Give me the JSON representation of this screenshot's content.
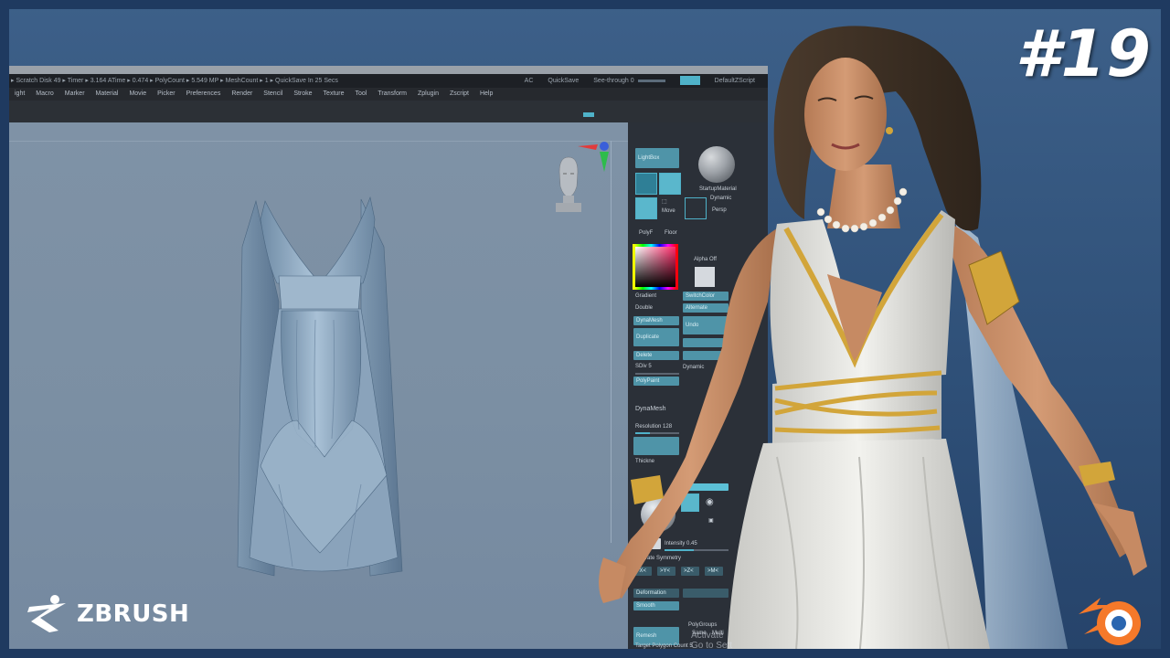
{
  "episode": "#19",
  "zbrush": {
    "status_left": "▸ Scratch Disk 49 ▸   Timer ▸ 3.164 ATime ▸ 0.474 ▸ PolyCount ▸ 5.549 MP  ▸ MeshCount ▸ 1  ▸ QuickSave In 25 Secs",
    "status_ac": "AC",
    "status_quicksave": "QuickSave",
    "status_see_through": "See-through  0",
    "status_script": "DefaultZScript",
    "menu": [
      "ight",
      "Macro",
      "Marker",
      "Material",
      "Movie",
      "Picker",
      "Preferences",
      "Render",
      "Stencil",
      "Stroke",
      "Texture",
      "Tool",
      "Transform",
      "Zplugin",
      "Zscript",
      "Help"
    ],
    "panel": {
      "lightbox": "LightBox",
      "material": "StartupMaterial",
      "move": "Move",
      "dynamic_small": "Dynamic",
      "persp": "Persp",
      "polyf": "PolyF",
      "floor": "Floor",
      "alpha_off": "Alpha Off",
      "gradient": "Gradient",
      "switch_color": "SwitchColor",
      "double": "Double",
      "alternate": "Alternate",
      "dynamesh_btn": "DynaMesh",
      "undo": "Undo",
      "duplicate": "Duplicate",
      "delete": "Delete",
      "sdiv": "SDiv 5",
      "dynamic": "Dynamic",
      "polypaint": "PolyPaint",
      "dynamesh": "DynaMesh",
      "resolution": "Resolution 128",
      "thickness": "Thickne",
      "intensity": "Intensity 0.45",
      "activate_symmetry": "Activate Symmetry",
      "x": ">X<",
      "y": ">Y<",
      "z": ">Z<",
      "m": ">M<",
      "deformation": "Deformation",
      "smooth": "Smooth",
      "remesh": "Remesh",
      "polygroups": "PolyGroups",
      "same": "Same",
      "multi": "Multi",
      "target_polygon": "Target Polygon Count 5"
    }
  },
  "watermark": {
    "line1": "Activate",
    "line2": "Go to Sett"
  },
  "logos": {
    "zbrush": "ZBRUSH",
    "blender": "blender-icon"
  },
  "colors": {
    "background": "#2e4f77",
    "accent": "#4fb2c9",
    "gold": "#d2a53a"
  }
}
